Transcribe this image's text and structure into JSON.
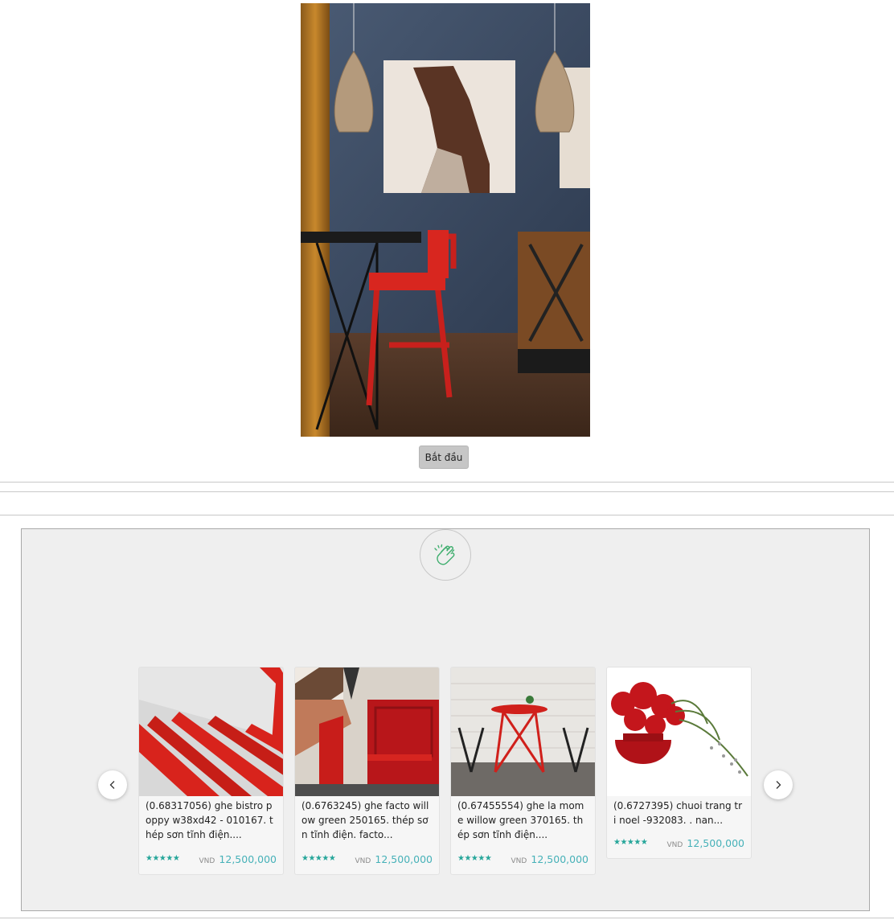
{
  "hero": {
    "start_button_label": "Bắt đầu"
  },
  "recommendations": {
    "badge_icon": "clapping-hands-icon",
    "prev_icon": "chevron-left-icon",
    "next_icon": "chevron-right-icon",
    "accent_color": "#46b1b8",
    "stars_color": "#26a69a",
    "items": [
      {
        "title": "(0.68317056) ghe bistro poppy w38xd42 - 010167. thép sơn tĩnh điện....",
        "stars": "★★★★★",
        "currency": "VND",
        "price": "12,500,000"
      },
      {
        "title": "(0.6763245) ghe facto willow green 250165. thép sơn tĩnh điện. facto...",
        "stars": "★★★★★",
        "currency": "VND",
        "price": "12,500,000"
      },
      {
        "title": "(0.67455554) ghe la mome willow green 370165. thép sơn tĩnh điện....",
        "stars": "★★★★★",
        "currency": "VND",
        "price": "12,500,000"
      },
      {
        "title": "(0.6727395) chuoi trang tri noel -932083. . nan...",
        "stars": "★★★★★",
        "currency": "VND",
        "price": "12,500,000"
      }
    ]
  }
}
